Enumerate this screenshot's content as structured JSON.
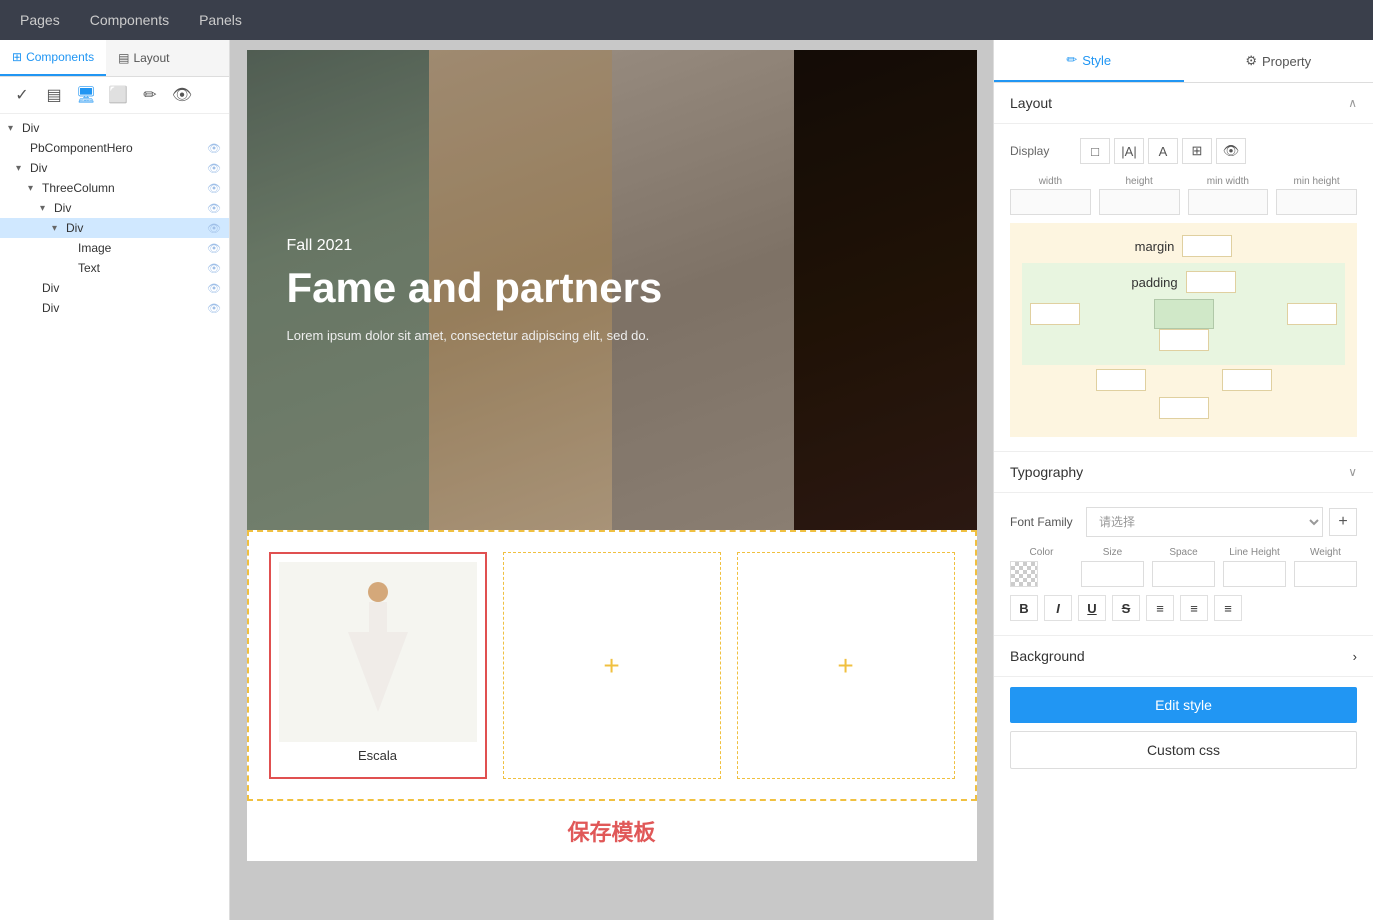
{
  "top_nav": {
    "items": [
      "Pages",
      "Components",
      "Panels"
    ]
  },
  "left_sidebar": {
    "tabs": [
      {
        "id": "components",
        "label": "Components",
        "icon": "⊞",
        "active": true
      },
      {
        "id": "layout",
        "label": "Layout",
        "icon": "▤",
        "active": false
      }
    ],
    "toolbar": {
      "icons": [
        "✓",
        "▤",
        "🖥",
        "⬜",
        "✏",
        "👁"
      ]
    },
    "tree": [
      {
        "id": "div-root",
        "label": "Div",
        "indent": 0,
        "expanded": true,
        "has_toggle": true
      },
      {
        "id": "pb-hero",
        "label": "PbComponentHero",
        "indent": 1,
        "has_toggle": false,
        "eye": true
      },
      {
        "id": "div-1",
        "label": "Div",
        "indent": 1,
        "expanded": true,
        "has_toggle": true,
        "eye": true
      },
      {
        "id": "three-col",
        "label": "ThreeColumn",
        "indent": 2,
        "has_toggle": true,
        "eye": true
      },
      {
        "id": "div-2",
        "label": "Div",
        "indent": 3,
        "expanded": true,
        "has_toggle": true,
        "eye": true
      },
      {
        "id": "div-selected",
        "label": "Div",
        "indent": 4,
        "expanded": true,
        "has_toggle": true,
        "eye": true,
        "selected": true
      },
      {
        "id": "image",
        "label": "Image",
        "indent": 5,
        "eye": true
      },
      {
        "id": "text",
        "label": "Text",
        "indent": 5,
        "eye": true
      },
      {
        "id": "div-3",
        "label": "Div",
        "indent": 2,
        "eye": true
      },
      {
        "id": "div-4",
        "label": "Div",
        "indent": 2,
        "eye": true
      }
    ]
  },
  "canvas": {
    "hero": {
      "subtitle": "Fall 2021",
      "title": "Fame and partners",
      "description": "Lorem ipsum dolor sit amet, consectetur adipiscing elit, sed do."
    },
    "three_col": {
      "cards": [
        {
          "id": "card-1",
          "label": "Escala",
          "has_image": true,
          "selected": true
        },
        {
          "id": "card-2",
          "label": "",
          "empty": true
        },
        {
          "id": "card-3",
          "label": "",
          "empty": true
        }
      ],
      "add_icon": "+"
    },
    "save_bar": {
      "label": "保存模板"
    }
  },
  "right_panel": {
    "tabs": [
      {
        "id": "style",
        "label": "Style",
        "icon": "✏",
        "active": true
      },
      {
        "id": "property",
        "label": "Property",
        "icon": "⚙",
        "active": false
      }
    ],
    "layout": {
      "label": "Layout",
      "display": {
        "label": "Display",
        "options": [
          "□",
          "|A|",
          "A",
          "⊞",
          "👁"
        ]
      },
      "size_fields": [
        {
          "id": "width",
          "label": "width",
          "value": ""
        },
        {
          "id": "height",
          "label": "height",
          "value": ""
        },
        {
          "id": "min_width",
          "label": "min width",
          "value": ""
        },
        {
          "id": "min_height",
          "label": "min height",
          "value": ""
        }
      ],
      "margin": {
        "label": "margin",
        "value": ""
      },
      "padding": {
        "label": "padding",
        "value": ""
      }
    },
    "typography": {
      "label": "Typography",
      "font_family": {
        "placeholder": "请选择",
        "add_label": "+"
      },
      "props": [
        {
          "id": "color",
          "label": "Color",
          "type": "swatch"
        },
        {
          "id": "size",
          "label": "Size",
          "value": ""
        },
        {
          "id": "space",
          "label": "Space",
          "value": ""
        },
        {
          "id": "line_height",
          "label": "Line Height",
          "value": ""
        },
        {
          "id": "weight",
          "label": "Weight",
          "value": ""
        }
      ],
      "format_buttons": [
        "B",
        "I",
        "U",
        "S",
        "≡",
        "≡",
        "≡"
      ]
    },
    "background": {
      "label": "Background"
    },
    "buttons": {
      "edit_style": "Edit style",
      "custom_css": "Custom css"
    }
  },
  "colors": {
    "accent_blue": "#2196f3",
    "selected_bg": "#d0e8ff",
    "hero_text": "#ffffff",
    "card_border_selected": "#e05050",
    "dashed_yellow": "#f0c040",
    "save_text": "#e05858",
    "margin_bg": "#fdf5e0",
    "padding_bg": "#e8f5e0"
  }
}
